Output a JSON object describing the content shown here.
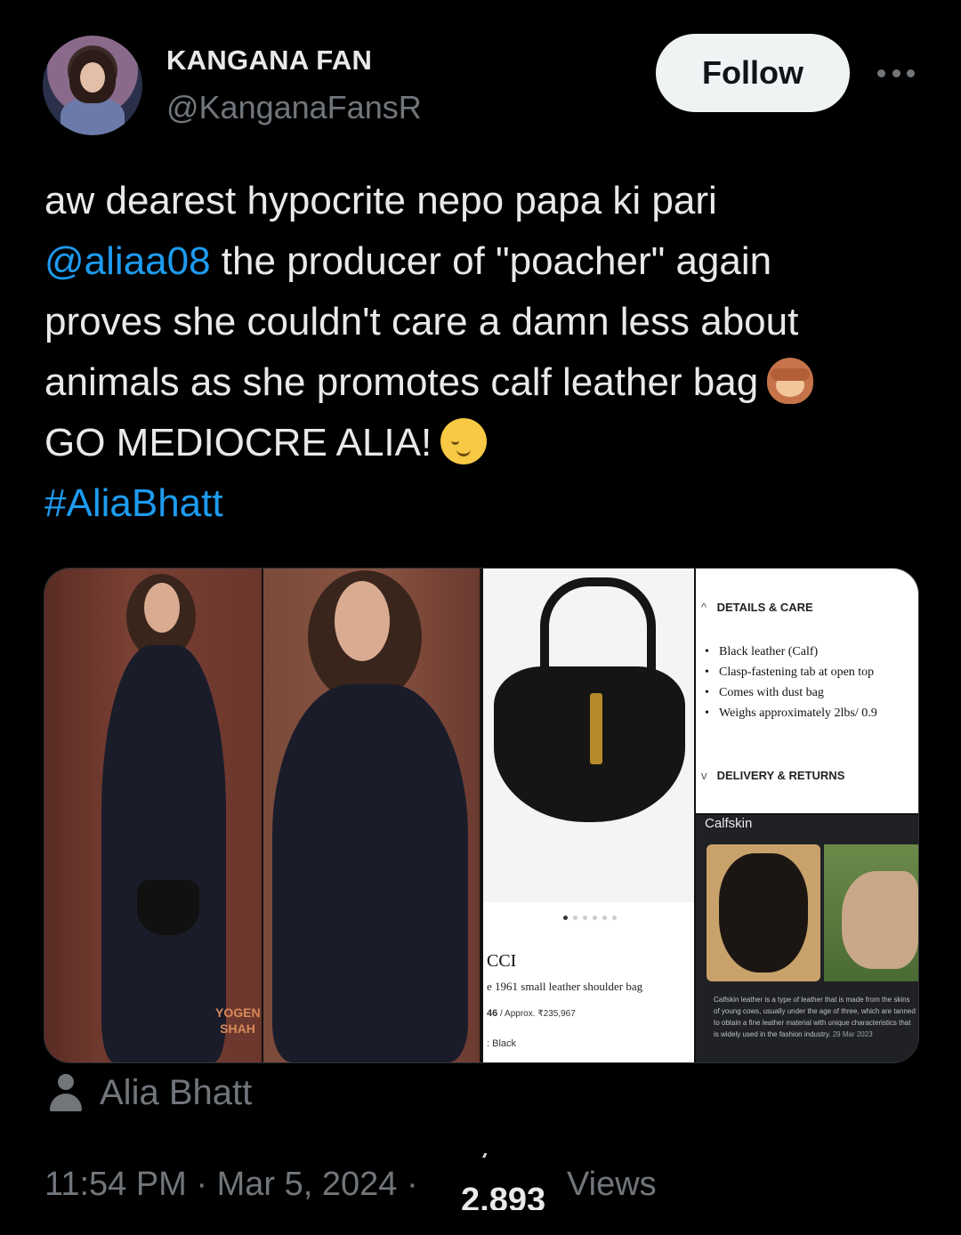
{
  "author": {
    "display_name": "KANGANA FAN",
    "handle": "@KanganaFansR",
    "follow_label": "Follow"
  },
  "tweet": {
    "line1": "aw dearest hypocrite nepo papa ki pari",
    "mention": "@aliaa08",
    "line2_rest": " the producer of \"poacher\" again",
    "line3": "proves she couldn't care a damn less about",
    "line4": "animals as she promotes calf leather bag",
    "line4_emoji": "see-no-evil-monkey",
    "line5": "GO MEDIOCRE ALIA!",
    "line5_emoji": "relieved-face",
    "hashtag": "#AliaBhatt"
  },
  "media": {
    "watermark": "YOGEN SHAH",
    "product": {
      "brand": "CCI",
      "name": "e 1961 small leather shoulder bag",
      "price_code": "46",
      "price_approx": "/ Approx. ₹235,967",
      "color": ": Black"
    },
    "details": {
      "details_header": "DETAILS & CARE",
      "items": [
        "Black leather (Calf)",
        "Clasp-fastening tab at open top",
        "Comes with dust bag",
        "Weighs approximately 2lbs/ 0.9"
      ],
      "delivery_header": "DELIVERY & RETURNS"
    },
    "calfskin": {
      "title": "Calfskin",
      "description": "Calfskin leather is a type of leather that is made from the skins of young cows, usually under the age of three, which are tanned to obtain a fine leather material with unique characteristics that is widely used in the fashion industry.",
      "date": "29 Mar 2023"
    }
  },
  "tag": {
    "name": "Alia Bhatt"
  },
  "meta": {
    "time_date": "11:54 PM · Mar 5, 2024 ·",
    "views_prev": "2,893",
    "views": "2,893",
    "views_label": "Views"
  },
  "colors": {
    "background": "#000000",
    "text": "#e7e9ea",
    "secondary": "#71767b",
    "link": "#1d9bf0",
    "follow_bg": "#eff3f4"
  }
}
